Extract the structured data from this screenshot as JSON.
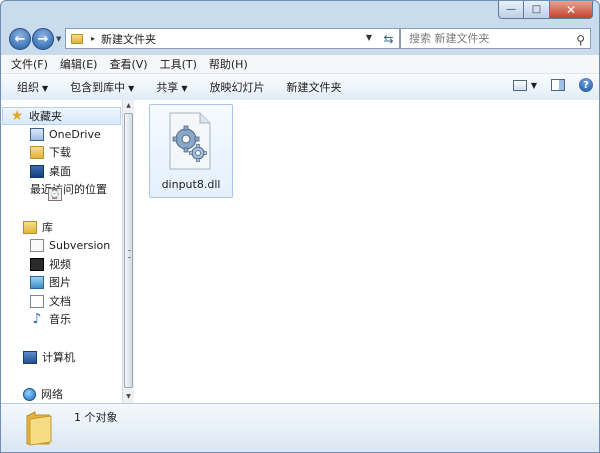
{
  "window": {
    "caption": {
      "minimize": "—",
      "maximize": "□",
      "close": "✕"
    }
  },
  "nav": {
    "back_icon": "back-arrow-icon",
    "forward_icon": "forward-arrow-icon",
    "breadcrumb_sep": "▸",
    "path": "新建文件夹",
    "search_placeholder": "搜索 新建文件夹"
  },
  "menu": [
    "文件(F)",
    "编辑(E)",
    "查看(V)",
    "工具(T)",
    "帮助(H)"
  ],
  "commands": {
    "organize": "组织",
    "include_library": "包含到库中",
    "share": "共享",
    "slideshow": "放映幻灯片",
    "new_folder": "新建文件夹"
  },
  "sidebar": {
    "favorites": {
      "label": "收藏夹",
      "items": [
        "OneDrive",
        "下载",
        "桌面",
        "最近访问的位置"
      ]
    },
    "libraries": {
      "label": "库",
      "items": [
        "Subversion",
        "视频",
        "图片",
        "文档",
        "音乐"
      ]
    },
    "computer": "计算机",
    "network": "网络"
  },
  "files": [
    {
      "name": "dinput8.dll",
      "icon": "dll-file-gears-icon"
    }
  ],
  "details": {
    "count": "1 个对象"
  },
  "colors": {
    "frame": "#c9dced",
    "accent": "#1f5aa6",
    "selection": "#d9e9fb"
  }
}
